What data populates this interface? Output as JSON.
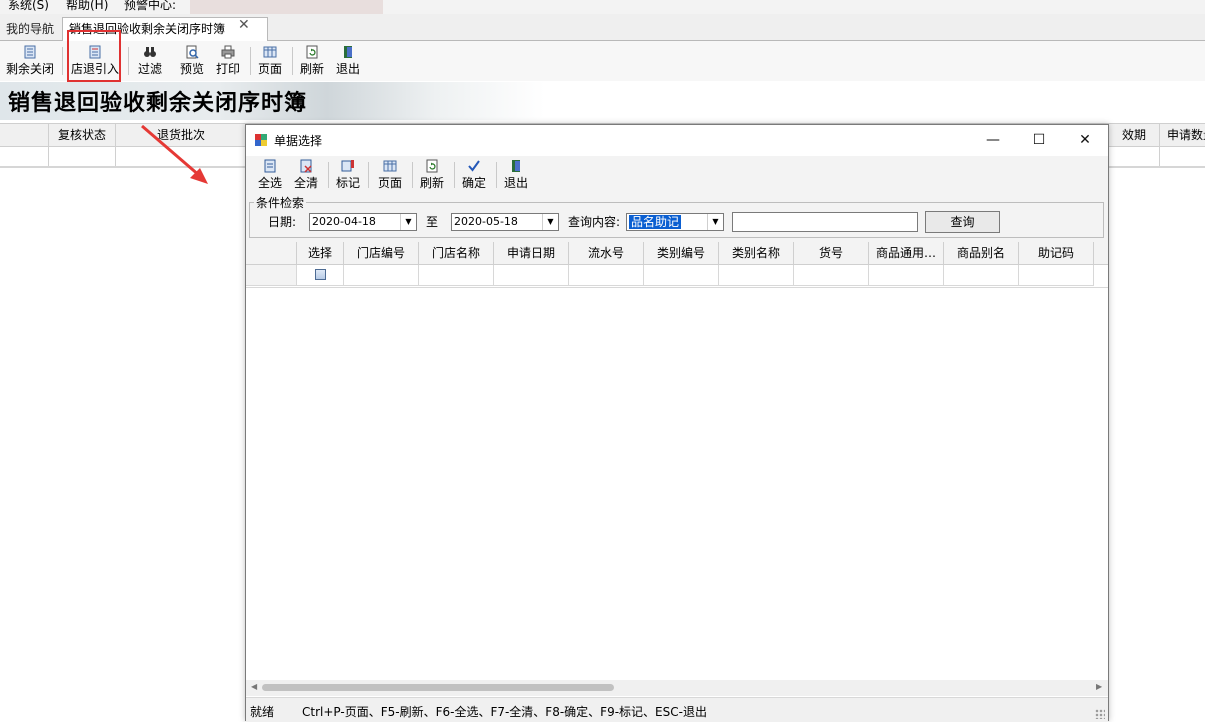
{
  "menubar": {
    "items": [
      "系统(S)",
      "帮助(H)",
      "预警中心:"
    ]
  },
  "tabs": [
    {
      "label": "我的导航"
    },
    {
      "label": "销售退回验收剩余关闭序时簿"
    }
  ],
  "toolbar": {
    "buttons": [
      "剩余关闭",
      "店退引入",
      "过滤",
      "预览",
      "打印",
      "页面",
      "刷新",
      "退出"
    ]
  },
  "banner": {
    "title": "销售退回验收剩余关闭序时簿"
  },
  "main_grid": {
    "columns": [
      "",
      "复核状态",
      "退货批次",
      "效期",
      "申请数量"
    ]
  },
  "dialog": {
    "title": "单据选择",
    "window_buttons": [
      "—",
      "☐",
      "✕"
    ],
    "toolbar": [
      "全选",
      "全清",
      "标记",
      "页面",
      "刷新",
      "确定",
      "退出"
    ],
    "conditions": {
      "legend": "条件检索",
      "date_label": "日期:",
      "date_from": "2020-04-18",
      "to_label": "至",
      "date_to": "2020-05-18",
      "query_label": "查询内容:",
      "query_field": "品名助记",
      "query_value": "",
      "query_button": "查询"
    },
    "grid": {
      "columns": [
        "",
        "选择",
        "门店编号",
        "门店名称",
        "申请日期",
        "流水号",
        "类别编号",
        "类别名称",
        "货号",
        "商品通用…",
        "商品别名",
        "助记码"
      ]
    },
    "status": {
      "state": "就绪",
      "shortcuts": "Ctrl+P-页面、F5-刷新、F6-全选、F7-全清、F8-确定、F9-标记、ESC-退出"
    }
  },
  "colors": {
    "accent_red": "#e03131",
    "selection_blue": "#0b5fd1"
  }
}
